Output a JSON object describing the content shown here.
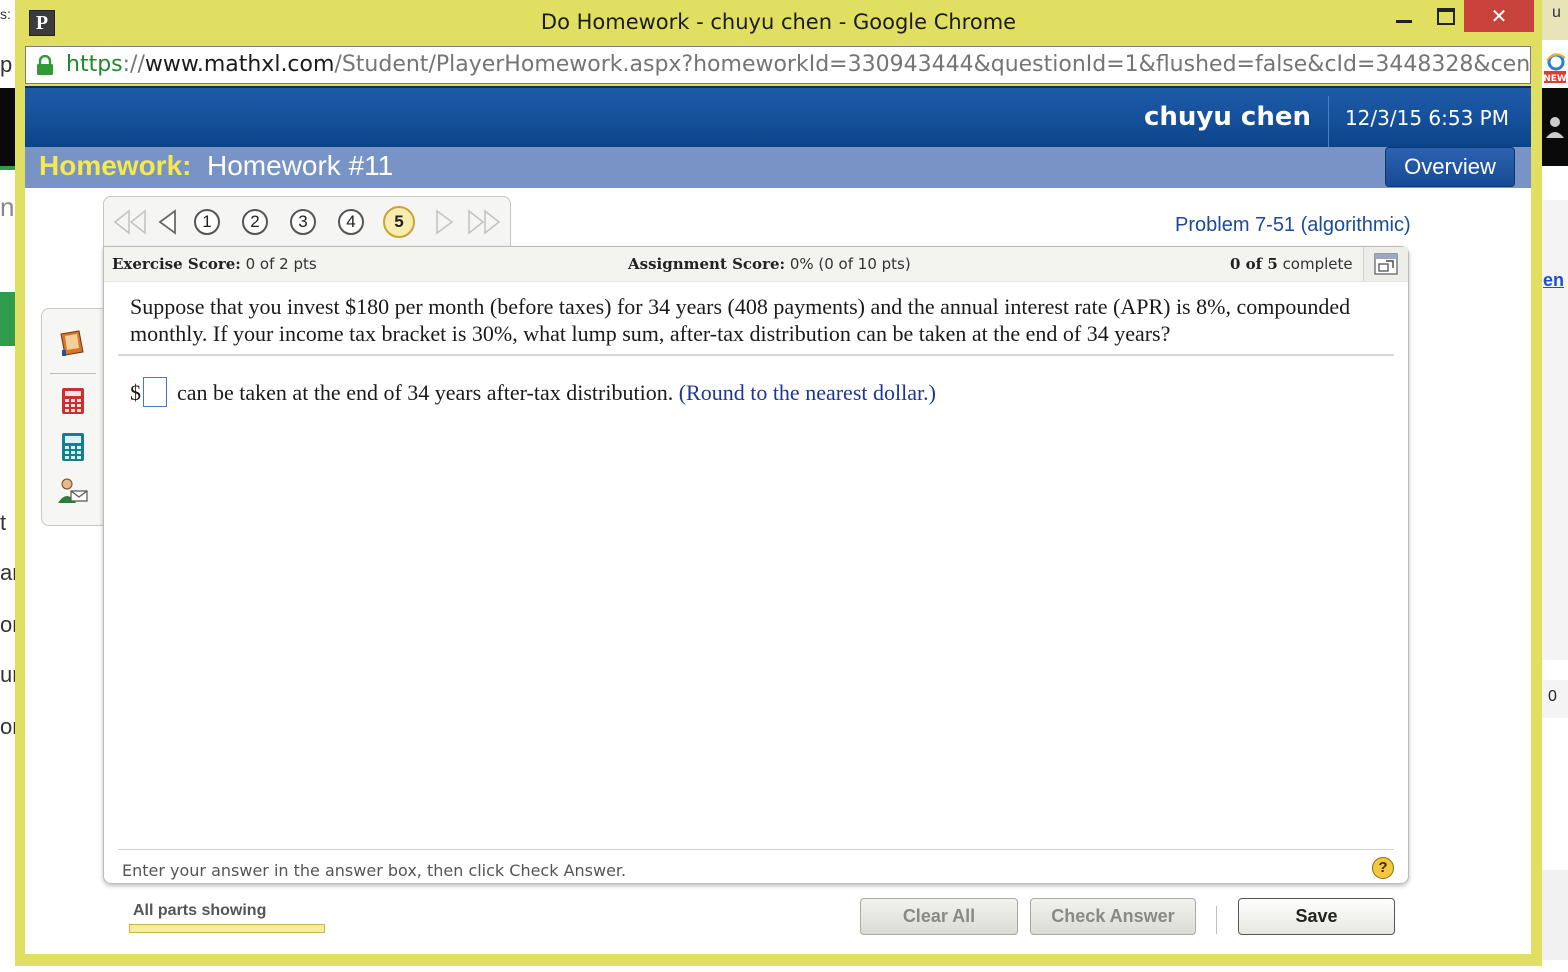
{
  "window": {
    "title": "Do Homework - chuyu chen - Google Chrome",
    "app_icon_letter": "P",
    "close_glyph": "✕"
  },
  "address": {
    "protocol": "https",
    "separator": "://",
    "host": "www.mathxl.com",
    "path": "/Student/PlayerHomework.aspx?homeworkId=330943444&questionId=1&flushed=false&cId=3448328&centerwin=yes"
  },
  "header": {
    "user": "chuyu chen",
    "datetime": "12/3/15 6:53 PM",
    "homework_label": "Homework:",
    "homework_name": "Homework #11",
    "overview_label": "Overview"
  },
  "nav": {
    "questions": [
      "1",
      "2",
      "3",
      "4",
      "5"
    ],
    "current": "5",
    "problem_id": "Problem 7-51 (algorithmic)"
  },
  "scores": {
    "exercise_label": "Exercise Score:",
    "exercise_value": "0 of 2 pts",
    "assignment_label": "Assignment Score:",
    "assignment_value": "0% (0 of 10 pts)",
    "complete_count": "0 of 5",
    "complete_label": "complete"
  },
  "question": {
    "text": "Suppose that you invest $180 per month (before taxes) for 34 years (408 payments) and the annual interest rate (APR) is 8%, compounded monthly. If your income tax bracket is 30%, what lump sum, after-tax distribution can be taken at the end of 34 years?",
    "answer_prefix": "$",
    "answer_value": "",
    "answer_suffix": "can be taken at the end of 34 years after-tax distribution.",
    "hint": "(Round to the nearest dollar.)"
  },
  "instruction": "Enter your answer in the answer box, then click Check Answer.",
  "help_glyph": "?",
  "footer": {
    "parts_label": "All parts showing",
    "clear_label": "Clear All",
    "check_label": "Check Answer",
    "save_label": "Save"
  },
  "background": {
    "left_fragments": [
      "s: (",
      "p",
      "n,",
      "t",
      "ar",
      "ora",
      "ur",
      "on"
    ],
    "right_fragments": [
      "u",
      "en",
      "0"
    ],
    "right_badge": "NEW"
  },
  "colors": {
    "chrome_frame": "#e1df62",
    "header_blue": "#15519c",
    "homework_band": "#7893c5",
    "homework_label": "#f6e94c",
    "link_blue": "#1b4a9b",
    "close_red": "#c7423a"
  }
}
